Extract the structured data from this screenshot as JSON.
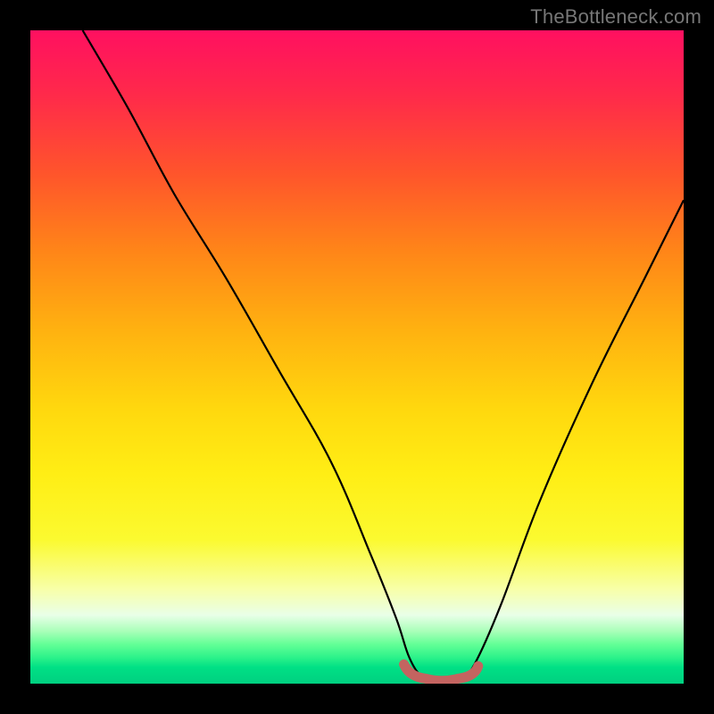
{
  "watermark": "TheBottleneck.com",
  "chart_data": {
    "type": "line",
    "title": "",
    "xlabel": "",
    "ylabel": "",
    "xlim": [
      0,
      100
    ],
    "ylim": [
      0,
      100
    ],
    "series": [
      {
        "name": "bottleneck-curve",
        "x": [
          8,
          15,
          22,
          30,
          38,
          46,
          52,
          56,
          58,
          60,
          62,
          64,
          66,
          68,
          72,
          78,
          86,
          94,
          100
        ],
        "y": [
          100,
          88,
          75,
          62,
          48,
          34,
          20,
          10,
          4,
          1,
          0.5,
          0.5,
          1,
          3,
          12,
          28,
          46,
          62,
          74
        ]
      }
    ],
    "background_gradient": {
      "top": "#ff1060",
      "mid": "#ffee15",
      "bottom": "#00d080"
    },
    "dip_marker": {
      "name": "dip-range-highlight",
      "color": "#c46460",
      "x_start": 58,
      "x_end": 68,
      "y": 0.5
    }
  }
}
